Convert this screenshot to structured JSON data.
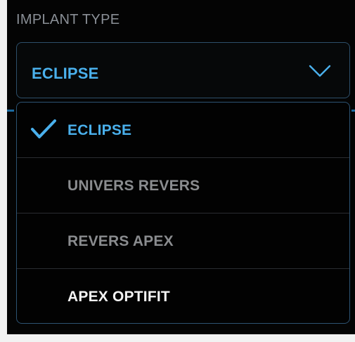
{
  "implant_type": {
    "label": "IMPLANT TYPE",
    "selected_value": "ECLIPSE",
    "toggle_icon": "chevron-down-icon",
    "options": [
      {
        "label": "ECLIPSE",
        "state": "selected",
        "icon": "checkmark-icon"
      },
      {
        "label": "UNIVERS REVERS",
        "state": "disabled"
      },
      {
        "label": "REVERS APEX",
        "state": "disabled"
      },
      {
        "label": "APEX OPTIFIT",
        "state": "enabled"
      }
    ]
  },
  "colors": {
    "background": "#040404",
    "accent": "#4ab0ec",
    "border": "#2d4f6a",
    "disabled_text": "#8a8c8f",
    "normal_text": "#f3f3f3",
    "label_text": "#8a8f96"
  }
}
